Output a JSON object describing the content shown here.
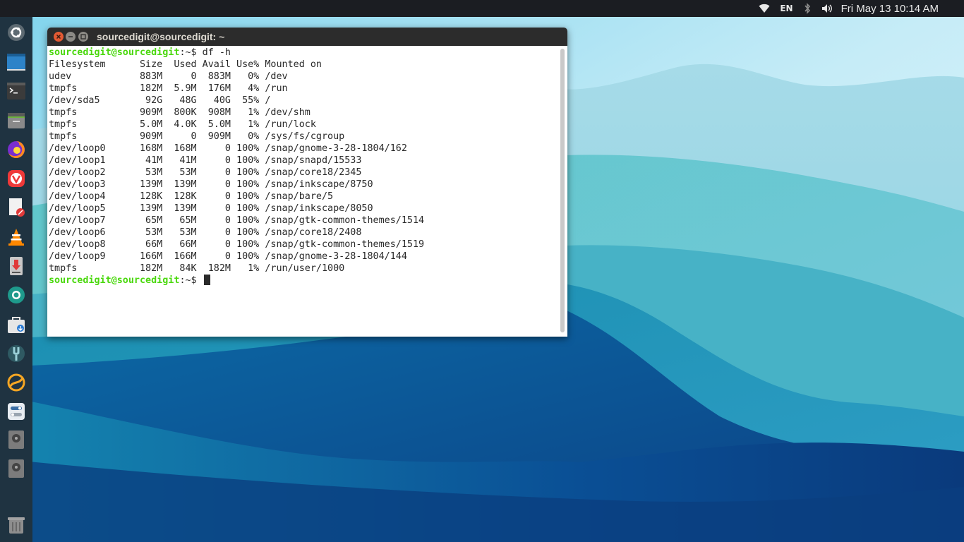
{
  "topbar": {
    "wifi_icon": "wifi-icon",
    "lang": "EN",
    "bluetooth_icon": "bluetooth-icon",
    "volume_icon": "volume-icon",
    "clock": "Fri May 13 10:14 AM"
  },
  "launcher": {
    "items": [
      {
        "name": "ubuntu-dash-icon"
      },
      {
        "name": "desktop-icon"
      },
      {
        "name": "terminal-icon"
      },
      {
        "name": "files-icon"
      },
      {
        "name": "firefox-icon"
      },
      {
        "name": "vivaldi-icon"
      },
      {
        "name": "text-editor-icon"
      },
      {
        "name": "vlc-icon"
      },
      {
        "name": "software-updater-icon"
      },
      {
        "name": "screenshot-icon"
      },
      {
        "name": "software-store-icon"
      },
      {
        "name": "tweaks-icon"
      },
      {
        "name": "network-icon"
      },
      {
        "name": "settings-toggle-icon"
      },
      {
        "name": "drive-icon"
      },
      {
        "name": "drive-icon"
      },
      {
        "name": "trash-icon"
      }
    ]
  },
  "terminal": {
    "title": "sourcedigit@sourcedigit: ~",
    "prompt_user": "sourcedigit@sourcedigit",
    "prompt_path": ":~$",
    "command": " df -h",
    "header": "Filesystem      Size  Used Avail Use% Mounted on",
    "lines": [
      "udev            883M     0  883M   0% /dev",
      "tmpfs           182M  5.9M  176M   4% /run",
      "/dev/sda5        92G   48G   40G  55% /",
      "tmpfs           909M  800K  908M   1% /dev/shm",
      "tmpfs           5.0M  4.0K  5.0M   1% /run/lock",
      "tmpfs           909M     0  909M   0% /sys/fs/cgroup",
      "/dev/loop0      168M  168M     0 100% /snap/gnome-3-28-1804/162",
      "/dev/loop1       41M   41M     0 100% /snap/snapd/15533",
      "/dev/loop2       53M   53M     0 100% /snap/core18/2345",
      "/dev/loop3      139M  139M     0 100% /snap/inkscape/8750",
      "/dev/loop4      128K  128K     0 100% /snap/bare/5",
      "/dev/loop5      139M  139M     0 100% /snap/inkscape/8050",
      "/dev/loop7       65M   65M     0 100% /snap/gtk-common-themes/1514",
      "/dev/loop6       53M   53M     0 100% /snap/core18/2408",
      "/dev/loop8       66M   66M     0 100% /snap/gtk-common-themes/1519",
      "/dev/loop9      166M  166M     0 100% /snap/gnome-3-28-1804/144",
      "tmpfs           182M   84K  182M   1% /run/user/1000"
    ]
  }
}
